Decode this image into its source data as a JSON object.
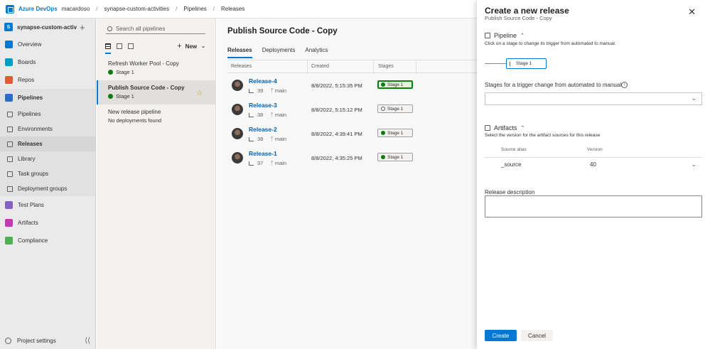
{
  "topbar": {
    "brand": "Azure DevOps",
    "org": "macardoso",
    "project": "synapse-custom-activities",
    "section": "Pipelines",
    "page": "Releases",
    "sep": "/"
  },
  "project": {
    "badge": "S",
    "name": "synapse-custom-activities"
  },
  "nav": {
    "overview": "Overview",
    "boards": "Boards",
    "repos": "Repos",
    "pipelines": "Pipelines",
    "sub_pipelines": "Pipelines",
    "environments": "Environments",
    "releases": "Releases",
    "library": "Library",
    "task_groups": "Task groups",
    "deployment_groups": "Deployment groups",
    "test_plans": "Test Plans",
    "artifacts": "Artifacts",
    "compliance": "Compliance",
    "project_settings": "Project settings"
  },
  "pipeline_list": {
    "search_placeholder": "Search all pipelines",
    "new_label": "New",
    "items": [
      {
        "name": "Refresh Worker Pool - Copy",
        "status": "Stage 1"
      },
      {
        "name": "Publish Source Code - Copy",
        "status": "Stage 1"
      },
      {
        "name": "New release pipeline",
        "status": "No deployments found"
      }
    ]
  },
  "main": {
    "title": "Publish Source Code - Copy",
    "tabs": [
      "Releases",
      "Deployments",
      "Analytics"
    ],
    "columns": {
      "releases": "Releases",
      "created": "Created",
      "stages": "Stages"
    },
    "rows": [
      {
        "name": "Release-4",
        "build": "39",
        "branch": "main",
        "created": "8/8/2022, 5:15:35 PM",
        "stage": "Stage 1"
      },
      {
        "name": "Release-3",
        "build": "38",
        "branch": "main",
        "created": "8/8/2022, 5:15:12 PM",
        "stage": "Stage 1"
      },
      {
        "name": "Release-2",
        "build": "38",
        "branch": "main",
        "created": "8/8/2022, 4:39:41 PM",
        "stage": "Stage 1"
      },
      {
        "name": "Release-1",
        "build": "37",
        "branch": "main",
        "created": "8/8/2022, 4:35:25 PM",
        "stage": "Stage 1"
      }
    ]
  },
  "dialog": {
    "title": "Create a new release",
    "subtitle": "Publish Source Code - Copy",
    "pipeline_heading": "Pipeline",
    "pipeline_hint": "Click on a stage to change its trigger from automated to manual.",
    "stage_name": "Stage 1",
    "stages_label": "Stages for a trigger change from automated to manual.",
    "artifacts_heading": "Artifacts",
    "artifacts_hint": "Select the version for the artifact sources for this release",
    "source_alias_col": "Source alias",
    "version_col": "Version",
    "source_alias": "_source",
    "version": "40",
    "description_label": "Release description",
    "create_label": "Create",
    "cancel_label": "Cancel"
  },
  "colors": {
    "accent": "#0078d4",
    "success": "#107c10"
  }
}
